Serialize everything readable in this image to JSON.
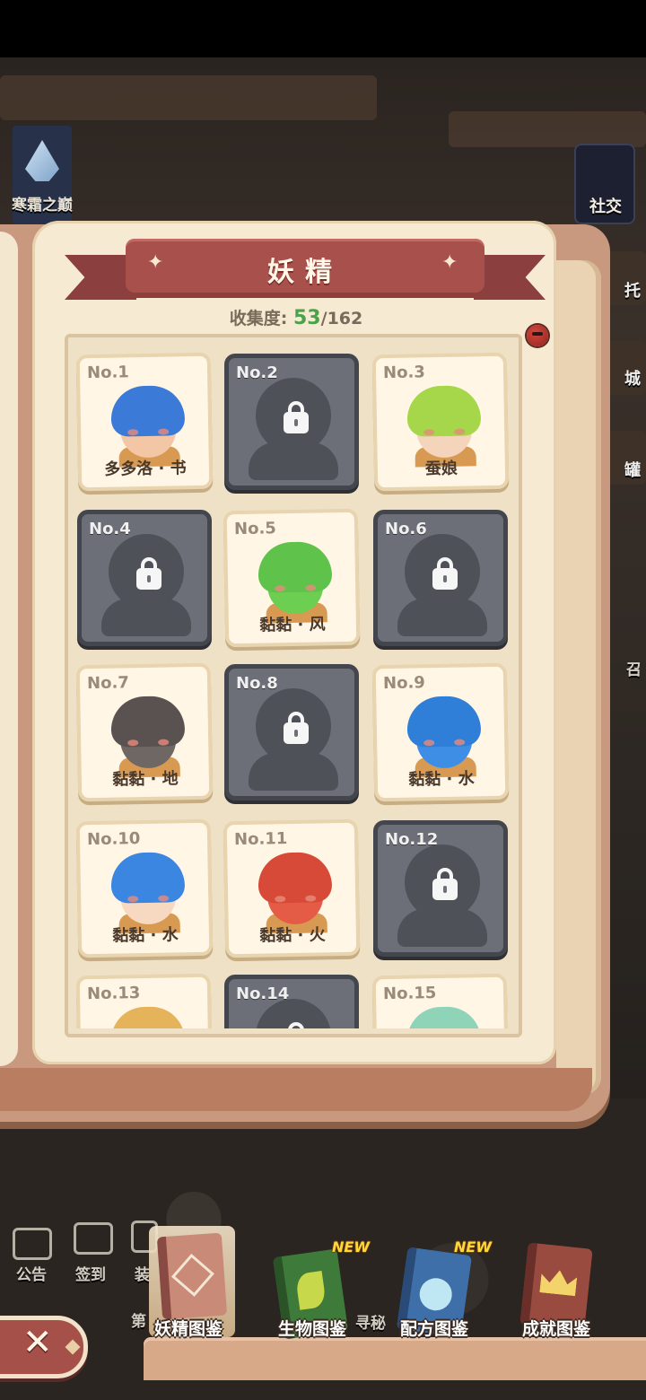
{
  "window": {
    "title": "妖精"
  },
  "collection": {
    "label": "收集度:",
    "current": "53",
    "total": "/162"
  },
  "cards": [
    {
      "no": "No.1",
      "name": "多多洛 · 书",
      "locked": false,
      "hair": "#3c7ad8",
      "face": "#f3c7a6"
    },
    {
      "no": "No.2",
      "name": "",
      "locked": true
    },
    {
      "no": "No.3",
      "name": "蚕娘",
      "locked": false,
      "hair": "#a6d64a",
      "face": "#f5d4bc"
    },
    {
      "no": "No.4",
      "name": "",
      "locked": true
    },
    {
      "no": "No.5",
      "name": "黏黏 · 风",
      "locked": false,
      "hair": "#5fc24a",
      "face": "#6ccf52"
    },
    {
      "no": "No.6",
      "name": "",
      "locked": true
    },
    {
      "no": "No.7",
      "name": "黏黏 · 地",
      "locked": false,
      "hair": "#5a5250",
      "face": "#6f6763"
    },
    {
      "no": "No.8",
      "name": "",
      "locked": true
    },
    {
      "no": "No.9",
      "name": "黏黏 · 水",
      "locked": false,
      "hair": "#2f7fd8",
      "face": "#3f8ee6"
    },
    {
      "no": "No.10",
      "name": "黏黏 · 水",
      "locked": false,
      "hair": "#3b86e0",
      "face": "#f7d9c2"
    },
    {
      "no": "No.11",
      "name": "黏黏 · 火",
      "locked": false,
      "hair": "#d84a38",
      "face": "#e45b46"
    },
    {
      "no": "No.12",
      "name": "",
      "locked": true
    },
    {
      "no": "No.13",
      "name": "",
      "locked": false,
      "hair": "#e4b35a",
      "face": "#f3d7b9"
    },
    {
      "no": "No.14",
      "name": "",
      "locked": true
    },
    {
      "no": "No.15",
      "name": "",
      "locked": false,
      "hair": "#8fd3b8",
      "face": "#f3d7b9"
    }
  ],
  "nav": {
    "items": [
      {
        "id": "fairy",
        "label": "妖精图鉴",
        "new": false,
        "active": true,
        "color": "#c98a77",
        "spine": "#8a4a44"
      },
      {
        "id": "creature",
        "label": "生物图鉴",
        "new": true,
        "new_label": "NEW",
        "active": false,
        "color": "#3e7a3a",
        "spine": "#2a5428"
      },
      {
        "id": "recipe",
        "label": "配方图鉴",
        "new": true,
        "new_label": "NEW",
        "active": false,
        "color": "#3f6fa8",
        "spine": "#2a4b78"
      },
      {
        "id": "achievement",
        "label": "成就图鉴",
        "new": false,
        "active": false,
        "color": "#9a4b40",
        "spine": "#6a2f28"
      }
    ]
  },
  "background": {
    "left_banner": "寒霜之巅",
    "right_social": "社交",
    "right_stubs": [
      "托",
      "城",
      "罐"
    ],
    "right_cut": "召",
    "hud": [
      "公告",
      "签到",
      "装"
    ],
    "bottom_hint": "寻秘",
    "bottom_hint2": "第"
  },
  "close": {
    "label": "✕"
  },
  "colors": {
    "accent": "#a8504c",
    "collect_green": "#4aa24a",
    "locked": "#6c6f78"
  }
}
